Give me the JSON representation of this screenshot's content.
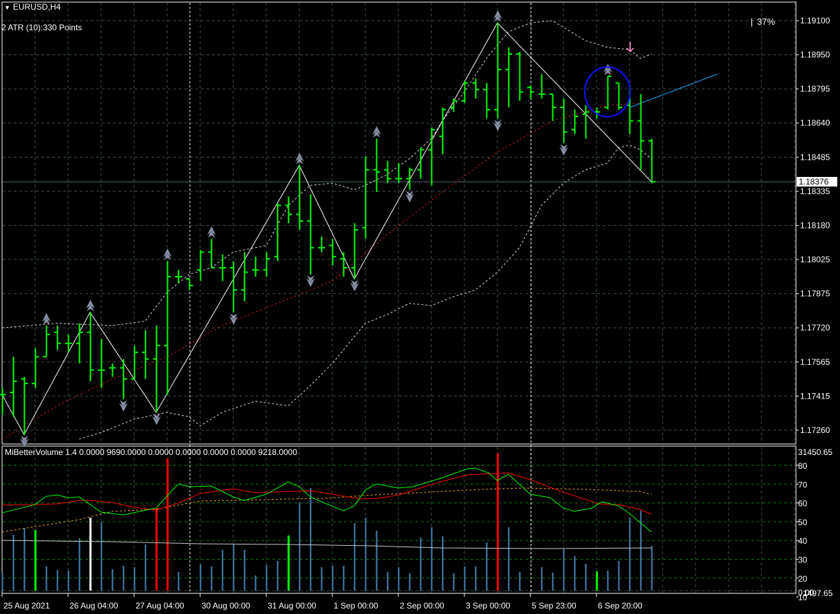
{
  "header": {
    "symbol_label": "EURUSD,H4",
    "atr_label": "2 ATR (10):330 Points",
    "percent_label": "37%",
    "current_price": "1.18376"
  },
  "volume_indicator": {
    "label": "MiBetterVolume 1.4 0.0000 9690.0000 0.0000 0.0000 0.0000 0.0000 9218.0000",
    "axis_top": "31450.65",
    "axis_bottom": "1497.65",
    "axis_zero": "0.00",
    "axis_levels": [
      "80",
      "70",
      "60",
      "50",
      "40",
      "30",
      "20",
      "10"
    ]
  },
  "colors": {
    "bar": "#00ff00",
    "grid": "#3e524d",
    "vol_grid": "#0a7a0a",
    "vol_default": "#4682b4",
    "upper_lower_band": "#d8d8d8",
    "ma": "#ff2020",
    "zigzag": "#ffffff",
    "trendline": "#1ea8ff",
    "circle": "#1010ff",
    "signal_arrow": "#ff88cc",
    "fractal": "#8a93a6",
    "osc_green": "#00ff00",
    "osc_red": "#ff0000",
    "osc_orange": "#f0a020",
    "vol_avg": "#c8c8c8"
  },
  "chart_data": {
    "type": "ohlc",
    "title": "EURUSD,H4",
    "ylim": [
      1.1726,
      1.191
    ],
    "price_ticks": [
      "1.19100",
      "1.18950",
      "1.18795",
      "1.18640",
      "1.18485",
      "1.18335",
      "1.18180",
      "1.18025",
      "1.17875",
      "1.17720",
      "1.17565",
      "1.17415",
      "1.17260"
    ],
    "time_labels": [
      "25 Aug 2021",
      "26 Aug 04:00",
      "27 Aug 04:00",
      "30 Aug 00:00",
      "31 Aug 00:00",
      "1 Sep 00:00",
      "2 Sep 00:00",
      "3 Sep 00:00",
      "5 Sep 23:00",
      "6 Sep 20:00"
    ],
    "time_label_bars": [
      0,
      6,
      12,
      18,
      24,
      30,
      36,
      42,
      48,
      54
    ],
    "separator_bars": [
      17,
      48
    ],
    "ohlc": [
      [
        1.1742,
        1.1745,
        1.1733,
        1.1742
      ],
      [
        1.1743,
        1.1759,
        1.1732,
        1.1748
      ],
      [
        1.1749,
        1.175,
        1.1724,
        1.1747
      ],
      [
        1.1747,
        1.1763,
        1.1745,
        1.1759
      ],
      [
        1.1759,
        1.1773,
        1.1759,
        1.1769
      ],
      [
        1.177,
        1.1773,
        1.1762,
        1.1765
      ],
      [
        1.1765,
        1.1769,
        1.1761,
        1.1765
      ],
      [
        1.1765,
        1.1774,
        1.1756,
        1.177
      ],
      [
        1.177,
        1.1779,
        1.1748,
        1.1753
      ],
      [
        1.1753,
        1.1767,
        1.1745,
        1.1753
      ],
      [
        1.1754,
        1.1756,
        1.175,
        1.1754
      ],
      [
        1.1754,
        1.1758,
        1.174,
        1.1749
      ],
      [
        1.1749,
        1.1764,
        1.1749,
        1.1761
      ],
      [
        1.1761,
        1.1771,
        1.1749,
        1.1758
      ],
      [
        1.1758,
        1.1773,
        1.1734,
        1.1764
      ],
      [
        1.1764,
        1.1802,
        1.1742,
        1.1795
      ],
      [
        1.1795,
        1.1798,
        1.1792,
        1.1795
      ],
      [
        1.1794,
        1.1794,
        1.1789,
        1.1791
      ],
      [
        1.1798,
        1.1807,
        1.1793,
        1.1806
      ],
      [
        1.1806,
        1.1812,
        1.1799,
        1.1799
      ],
      [
        1.1799,
        1.1805,
        1.1793,
        1.1799
      ],
      [
        1.1799,
        1.1802,
        1.1779,
        1.1789
      ],
      [
        1.1789,
        1.1806,
        1.1784,
        1.1797
      ],
      [
        1.1798,
        1.1804,
        1.1795,
        1.1798
      ],
      [
        1.1798,
        1.1806,
        1.1795,
        1.1803
      ],
      [
        1.1804,
        1.1828,
        1.1802,
        1.1827
      ],
      [
        1.1827,
        1.1831,
        1.1819,
        1.1823
      ],
      [
        1.1823,
        1.1845,
        1.1816,
        1.182
      ],
      [
        1.182,
        1.1832,
        1.1796,
        1.1808
      ],
      [
        1.1808,
        1.1813,
        1.1806,
        1.1808
      ],
      [
        1.1809,
        1.1812,
        1.18,
        1.1804
      ],
      [
        1.1803,
        1.1806,
        1.1795,
        1.1799
      ],
      [
        1.1799,
        1.1819,
        1.1794,
        1.1816
      ],
      [
        1.1817,
        1.1849,
        1.1812,
        1.1843
      ],
      [
        1.1843,
        1.1857,
        1.1833,
        1.1842
      ],
      [
        1.1843,
        1.1847,
        1.1837,
        1.1839
      ],
      [
        1.1839,
        1.1846,
        1.1837,
        1.1839
      ],
      [
        1.1839,
        1.1844,
        1.1834,
        1.1843
      ],
      [
        1.1843,
        1.1853,
        1.1839,
        1.1852
      ],
      [
        1.1852,
        1.1862,
        1.1836,
        1.1861
      ],
      [
        1.1858,
        1.1871,
        1.185,
        1.187
      ],
      [
        1.1871,
        1.1875,
        1.1869,
        1.1874
      ],
      [
        1.1874,
        1.1883,
        1.1873,
        1.1882
      ],
      [
        1.1882,
        1.1884,
        1.1875,
        1.1879
      ],
      [
        1.1879,
        1.1882,
        1.1866,
        1.187
      ],
      [
        1.187,
        1.1909,
        1.1866,
        1.1888
      ],
      [
        1.1888,
        1.1898,
        1.1871,
        1.1895
      ],
      [
        1.1895,
        1.1896,
        1.1874,
        1.1878
      ],
      [
        1.188,
        1.1881,
        1.1875,
        1.1878
      ],
      [
        1.1877,
        1.1886,
        1.1875,
        1.1877
      ],
      [
        1.1877,
        1.1877,
        1.1865,
        1.1871
      ],
      [
        1.1871,
        1.1875,
        1.1855,
        1.186
      ],
      [
        1.1861,
        1.187,
        1.1859,
        1.1867
      ],
      [
        1.1868,
        1.1872,
        1.1857,
        1.1869
      ],
      [
        1.1869,
        1.1871,
        1.1866,
        1.1869
      ],
      [
        1.1871,
        1.1885,
        1.187,
        1.1885
      ],
      [
        1.1882,
        1.1882,
        1.187,
        1.1871
      ],
      [
        1.1872,
        1.1881,
        1.1859,
        1.1865
      ],
      [
        1.1865,
        1.1877,
        1.1843,
        1.1856
      ],
      [
        1.1856,
        1.1857,
        1.1837,
        1.18376
      ]
    ],
    "upper_band": [
      [
        0,
        1.1772
      ],
      [
        5,
        1.1774
      ],
      [
        10,
        1.1773
      ],
      [
        13,
        1.1775
      ],
      [
        15,
        1.1788
      ],
      [
        17,
        1.1796
      ],
      [
        19,
        1.1799
      ],
      [
        21,
        1.1806
      ],
      [
        24,
        1.1809
      ],
      [
        26,
        1.1827
      ],
      [
        28,
        1.1836
      ],
      [
        30,
        1.1837
      ],
      [
        32,
        1.1834
      ],
      [
        33,
        1.1836
      ],
      [
        35,
        1.1841
      ],
      [
        37,
        1.1848
      ],
      [
        39,
        1.1857
      ],
      [
        40,
        1.1865
      ],
      [
        42,
        1.1878
      ],
      [
        44,
        1.1893
      ],
      [
        46,
        1.1905
      ],
      [
        48,
        1.1909
      ],
      [
        50,
        1.191
      ],
      [
        51,
        1.1907
      ],
      [
        53,
        1.1901
      ],
      [
        55,
        1.1898
      ],
      [
        57,
        1.1897
      ],
      [
        58,
        1.1893
      ],
      [
        59,
        1.1895
      ]
    ],
    "lower_band": [
      [
        7,
        1.1722
      ],
      [
        9,
        1.1725
      ],
      [
        12,
        1.1731
      ],
      [
        15,
        1.1734
      ],
      [
        17,
        1.1732
      ],
      [
        18,
        1.1728
      ],
      [
        20,
        1.1734
      ],
      [
        23,
        1.1739
      ],
      [
        26,
        1.1737
      ],
      [
        28,
        1.1746
      ],
      [
        30,
        1.1756
      ],
      [
        33,
        1.1774
      ],
      [
        35,
        1.1778
      ],
      [
        37,
        1.1783
      ],
      [
        39,
        1.1782
      ],
      [
        41,
        1.1786
      ],
      [
        43,
        1.1789
      ],
      [
        45,
        1.1797
      ],
      [
        47,
        1.1808
      ],
      [
        49,
        1.1827
      ],
      [
        51,
        1.1837
      ],
      [
        53,
        1.1843
      ],
      [
        55,
        1.1846
      ],
      [
        56,
        1.1853
      ],
      [
        57,
        1.1854
      ],
      [
        58,
        1.1852
      ],
      [
        59,
        1.1848
      ]
    ],
    "moving_average": [
      [
        0,
        1.1722
      ],
      [
        5,
        1.1737
      ],
      [
        10,
        1.1749
      ],
      [
        15,
        1.1759
      ],
      [
        20,
        1.1773
      ],
      [
        25,
        1.1783
      ],
      [
        30,
        1.1793
      ],
      [
        35,
        1.1814
      ],
      [
        40,
        1.1833
      ],
      [
        45,
        1.1851
      ],
      [
        50,
        1.1865
      ],
      [
        55,
        1.1872
      ],
      [
        58,
        1.1873
      ]
    ],
    "zigzag": [
      [
        0,
        1.1742
      ],
      [
        2,
        1.1724
      ],
      [
        8,
        1.1779
      ],
      [
        14,
        1.1734
      ],
      [
        27,
        1.1845
      ],
      [
        32,
        1.1794
      ],
      [
        45,
        1.1909
      ],
      [
        59,
        1.18376
      ]
    ],
    "trendline": [
      [
        57,
        1.1871
      ],
      [
        65,
        1.1886
      ]
    ],
    "highlight_circle": [
      55,
      1.1878
    ],
    "signal_arrow": [
      57,
      1.1898
    ],
    "fractals_up": [
      4,
      8,
      15,
      19,
      27,
      34,
      45,
      55
    ],
    "fractals_down": [
      2,
      11,
      14,
      21,
      28,
      32,
      37,
      45,
      51
    ],
    "volume": {
      "ylim": [
        1497.65,
        31450.65
      ],
      "values": [
        5333,
        13446,
        14920,
        14478,
        6660,
        5923,
        5776,
        12708,
        17133,
        16248,
        6070,
        6808,
        6513,
        11381,
        19198,
        29818,
        5481,
        0,
        7103,
        6660,
        10200,
        11528,
        10200,
        4743,
        6955,
        7840,
        13298,
        20230,
        23476,
        6513,
        6808,
        6808,
        15953,
        17133,
        14331,
        5481,
        6513,
        5186,
        12856,
        15068,
        13151,
        5186,
        6660,
        6660,
        11823,
        31000,
        15068,
        5481,
        0,
        6513,
        5333,
        10348,
        8873,
        7250,
        5628,
        5776,
        7840,
        17133,
        18608,
        11086
      ],
      "colors": {
        "3": "#00ff00",
        "26": "#00ff00",
        "54": "#00ff00",
        "8": "#ffffff",
        "14": "#ff0000",
        "15": "#ff0000",
        "45": "#ff0000"
      },
      "average": [
        [
          0,
          12265
        ],
        [
          10,
          11970
        ],
        [
          18,
          11528
        ],
        [
          26,
          11380
        ],
        [
          33.6,
          11085
        ],
        [
          40,
          10643
        ],
        [
          50,
          10500
        ],
        [
          59,
          10643
        ]
      ]
    },
    "oscillator": {
      "ylim": [
        10,
        80
      ],
      "green": [
        [
          0,
          54.7
        ],
        [
          3,
          59.1
        ],
        [
          4,
          63.5
        ],
        [
          5,
          64.2
        ],
        [
          6,
          62.8
        ],
        [
          7,
          63.2
        ],
        [
          9,
          55.1
        ],
        [
          11,
          53.6
        ],
        [
          14,
          57.3
        ],
        [
          16,
          70.1
        ],
        [
          17,
          68.6
        ],
        [
          19,
          69.0
        ],
        [
          21,
          63.2
        ],
        [
          22,
          61.3
        ],
        [
          24,
          64.6
        ],
        [
          26,
          71.2
        ],
        [
          27,
          68.6
        ],
        [
          28,
          63.2
        ],
        [
          29.2,
          60.2
        ],
        [
          31,
          55.8
        ],
        [
          32,
          58.4
        ],
        [
          33,
          66.8
        ],
        [
          34,
          70.1
        ],
        [
          36,
          67.9
        ],
        [
          37.3,
          68.6
        ],
        [
          39.8,
          73.0
        ],
        [
          42.3,
          78.2
        ],
        [
          43,
          78.5
        ],
        [
          44.2,
          76.0
        ],
        [
          45,
          71.9
        ],
        [
          46,
          75.2
        ],
        [
          48,
          64.6
        ],
        [
          49.8,
          62.8
        ],
        [
          51,
          57.3
        ],
        [
          52,
          55.5
        ],
        [
          53.6,
          57.3
        ],
        [
          54.5,
          60.6
        ],
        [
          56,
          58.4
        ],
        [
          57,
          54.4
        ],
        [
          59,
          44.5
        ]
      ],
      "red": [
        [
          0,
          58.8
        ],
        [
          3,
          59.1
        ],
        [
          5,
          59.5
        ],
        [
          7,
          61.3
        ],
        [
          8,
          61.3
        ],
        [
          10,
          60.2
        ],
        [
          12,
          57.7
        ],
        [
          14,
          56.2
        ],
        [
          16,
          59.9
        ],
        [
          18,
          65.0
        ],
        [
          21,
          67.5
        ],
        [
          23,
          65.4
        ],
        [
          26,
          66.1
        ],
        [
          28,
          66.5
        ],
        [
          29.2,
          65.4
        ],
        [
          32.6,
          62.1
        ],
        [
          34.2,
          62.4
        ],
        [
          36,
          64.2
        ],
        [
          39.8,
          71.2
        ],
        [
          42.3,
          74.9
        ],
        [
          46,
          76.0
        ],
        [
          48,
          72.3
        ],
        [
          51,
          65.7
        ],
        [
          54.2,
          59.5
        ],
        [
          56,
          59.1
        ],
        [
          57.9,
          56.6
        ],
        [
          59,
          54.0
        ]
      ],
      "orange": [
        [
          0,
          44.5
        ],
        [
          3,
          47.4
        ],
        [
          7,
          51.1
        ],
        [
          10,
          55.5
        ],
        [
          14,
          56.6
        ],
        [
          18,
          61.0
        ],
        [
          21,
          61.3
        ],
        [
          26,
          62.1
        ],
        [
          29.2,
          62.4
        ],
        [
          33.6,
          64.2
        ],
        [
          38.6,
          65.7
        ],
        [
          43.6,
          67.2
        ],
        [
          47.3,
          67.9
        ],
        [
          53,
          67.2
        ],
        [
          57.9,
          66.1
        ],
        [
          59,
          64.6
        ]
      ]
    }
  }
}
